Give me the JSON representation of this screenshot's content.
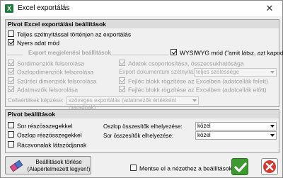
{
  "window": {
    "title": "Excel exportálás",
    "app_icon_glyph": "X",
    "close_glyph": "✕"
  },
  "pivot_export": {
    "header": "Pivot Excel exportálási beállítások",
    "full_recalc": {
      "label": "Teljes szétnyitással történjen az exportálás",
      "checked": false
    },
    "raw_mode": {
      "label": "Nyers adat mód",
      "checked": true
    },
    "wysiwyg": {
      "label": "WYSIWYG mód (\"amit látsz, azt kapod\")",
      "checked": true
    },
    "display_settings_header": "Export megjelenési beállítások",
    "left_options": [
      {
        "label": "Sordimenziók felsorolása",
        "checked": true
      },
      {
        "label": "Oszlopdimenziók felsorolása",
        "checked": true
      },
      {
        "label": "Szűrési dimenziók felsorolása",
        "checked": true
      },
      {
        "label": "Adatmezők felsorolása",
        "checked": true
      }
    ],
    "data_grouping": {
      "label": "Adatok csoportosítása, összecsukhatósága",
      "checked": true
    },
    "export_doc_width": {
      "label": "Export dokumentum szétnyitása:",
      "value": "teljes szélessége"
    },
    "right_options": [
      {
        "label": "Fejléc blokk rögzítése az Excelben (adatcellák felett)",
        "checked": true
      },
      {
        "label": "Fejléc blokk rögzítése az Excelben (adatcellák előtt)",
        "checked": true
      }
    ],
    "cell_text": {
      "label": "Cellaértékek képzése:",
      "value": "szöveges exportálás (adatmezők értékként maradnak)"
    }
  },
  "pivot_settings": {
    "header": "Pivot beállítások",
    "row_subtotals": {
      "label": "Sor részösszegekkel",
      "checked": false
    },
    "col_subtotals": {
      "label": "Oszlop részösszegekkel",
      "checked": false
    },
    "grid_lines": {
      "label": "Rácsvonalak látszódjanak",
      "checked": false
    },
    "col_totals_pos": {
      "label": "Oszlop összesítők elhelyezése:",
      "value": "közel"
    },
    "row_totals_pos": {
      "label": "Sor összesítők elhelyezése:",
      "value": "közel"
    }
  },
  "footer": {
    "reset_label": "Beállítások törlése\n(Alapértelmezett legyen!)",
    "save_for_view": {
      "label": "Mentse el a nézethez a beállításokat",
      "checked": false
    }
  },
  "colors": {
    "ok_green": "#3c9a2e",
    "cancel_red": "#d23b2f"
  }
}
